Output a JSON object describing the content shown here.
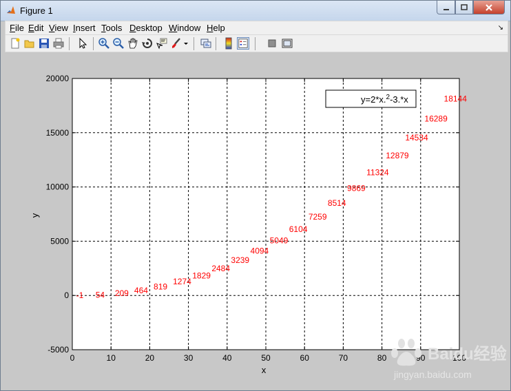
{
  "window": {
    "title": "Figure 1"
  },
  "menu": [
    "File",
    "Edit",
    "View",
    "Insert",
    "Tools",
    "Desktop",
    "Window",
    "Help"
  ],
  "toolbar_icons": [
    "new-figure-icon",
    "open-file-icon",
    "save-icon",
    "print-icon",
    "edit-plot-icon",
    "zoom-in-icon",
    "zoom-out-icon",
    "pan-icon",
    "rotate-3d-icon",
    "data-cursor-icon",
    "brush-icon",
    "brush-menu-icon",
    "link-plot-icon",
    "insert-colorbar-icon",
    "insert-legend-icon",
    "hide-plot-tools-icon",
    "show-plot-tools-icon"
  ],
  "chart_data": {
    "type": "scatter",
    "xlabel": "x",
    "ylabel": "y",
    "xlim": [
      0,
      100
    ],
    "ylim": [
      -5000,
      20000
    ],
    "x_ticks": [
      0,
      10,
      20,
      30,
      40,
      50,
      60,
      70,
      80,
      90,
      100
    ],
    "y_ticks": [
      -5000,
      0,
      5000,
      10000,
      15000,
      20000
    ],
    "x_tick_labels": [
      "0",
      "10",
      "20",
      "30",
      "40",
      "50",
      "60",
      "70",
      "80",
      "90",
      "100"
    ],
    "y_tick_labels": [
      "-5000",
      "0",
      "5000",
      "10000",
      "15000",
      "20000"
    ],
    "grid": true,
    "legend": {
      "text": "y=2*x.^2-3.*x",
      "position": "top-right"
    },
    "series_color": "#ff0000",
    "x": [
      1,
      6,
      11,
      16,
      21,
      26,
      31,
      36,
      41,
      46,
      51,
      56,
      61,
      66,
      71,
      76,
      81,
      86,
      91,
      96
    ],
    "y": [
      -1,
      54,
      209,
      464,
      819,
      1274,
      1829,
      2484,
      3239,
      4094,
      5049,
      6104,
      7259,
      8514,
      9869,
      11324,
      12879,
      14534,
      16289,
      18144
    ],
    "labels": [
      "-1",
      "54",
      "209",
      "464",
      "819",
      "1274",
      "1829",
      "2484",
      "3239",
      "4094",
      "5049",
      "6104",
      "7259",
      "8514",
      "9869",
      "11324",
      "12879",
      "14534",
      "16289",
      "18144"
    ]
  },
  "watermark": {
    "brand": "Baidu经验",
    "url": "jingyan.baidu.com"
  }
}
